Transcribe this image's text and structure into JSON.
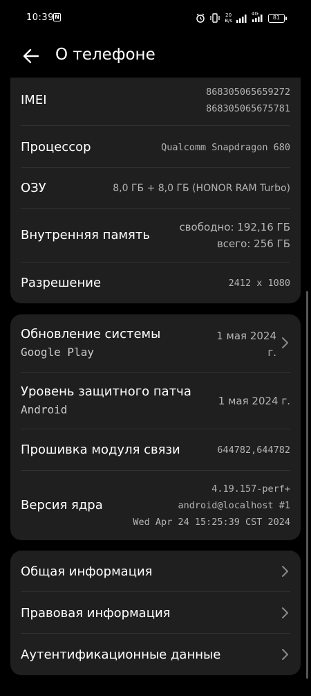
{
  "status_bar": {
    "time": "10:39",
    "nfc": "N",
    "speed_value": "20",
    "speed_unit": "B/s",
    "network": "4G",
    "battery": "81"
  },
  "header": {
    "title": "О телефоне"
  },
  "card1": {
    "imei": {
      "label": "IMEI",
      "value1": "868305065659272",
      "value2": "868305065675781"
    },
    "processor": {
      "label": "Процессор",
      "value": "Qualcomm Snapdragon 680"
    },
    "ram": {
      "label": "ОЗУ",
      "value": "8,0 ГБ + 8,0 ГБ (HONOR RAM Turbo)"
    },
    "storage": {
      "label": "Внутренняя память",
      "value1": "свободно: 192,16 ГБ",
      "value2": "всего: 256 ГБ"
    },
    "resolution": {
      "label": "Разрешение",
      "value": "2412 x 1080"
    }
  },
  "card2": {
    "system_update": {
      "label": "Обновление системы",
      "sublabel": "Google Play",
      "value1": "1 мая 2024",
      "value2": "г."
    },
    "patch": {
      "label": "Уровень защитного патча",
      "sublabel": "Android",
      "value": "1 мая 2024 г."
    },
    "baseband": {
      "label": "Прошивка модуля связи",
      "value": "644782,644782"
    },
    "kernel": {
      "label": "Версия ядра",
      "value1": "4.19.157-perf+",
      "value2": "android@localhost #1",
      "value3": "Wed Apr 24 15:25:39 CST 2024"
    }
  },
  "card3": {
    "general": {
      "label": "Общая информация"
    },
    "legal": {
      "label": "Правовая информация"
    },
    "auth": {
      "label": "Аутентификационные данные"
    }
  },
  "colors": {
    "background": "#000000",
    "card": "#1f1f1f",
    "divider": "#333333",
    "value_text": "#b4b4b4"
  }
}
